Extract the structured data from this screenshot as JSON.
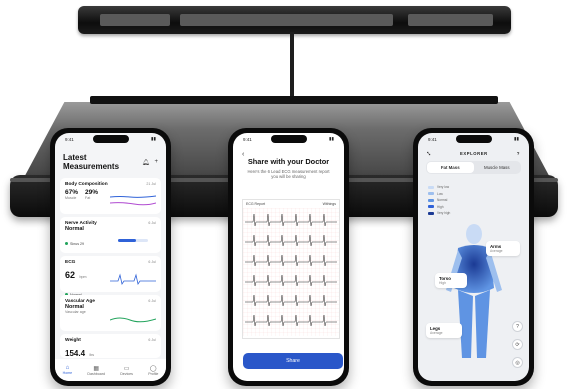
{
  "phone_left": {
    "status_time": "9:41",
    "title": "Latest Measurements",
    "cards": [
      {
        "title": "Body Composition",
        "date": "21 Jul",
        "left_value": "67%",
        "left_label": "Muscle",
        "right_value": "29%",
        "right_label": "Fat"
      },
      {
        "title": "Nerve Activity",
        "date": "6 Jul",
        "value": "Normal",
        "badge": "Sinus 29"
      },
      {
        "title": "ECG",
        "date": "6 Jul",
        "value": "62",
        "unit": "bpm",
        "badge": "Normal"
      },
      {
        "title": "Vascular Age",
        "date": "6 Jul",
        "value": "Normal",
        "note": "Vascular age"
      },
      {
        "title": "Weight",
        "date": "6 Jul",
        "value": "154.4",
        "unit": "lbs"
      }
    ],
    "tabs": [
      "Home",
      "Dashboard",
      "Devices",
      "Profile"
    ],
    "accent": "#2f62d8"
  },
  "phone_center": {
    "status_time": "9:41",
    "title": "Share with your Doctor",
    "subtitle": "Here's the 6 Lead ECG measurement report you will be sharing",
    "sheet_left": "ECG Report",
    "sheet_right": "Withings",
    "share_label": "Share",
    "button_color": "#2a57c9"
  },
  "phone_right": {
    "status_time": "9:41",
    "title": "EXPLORER",
    "segment_fat": "Fat Mass",
    "segment_muscle": "Muscle Mass",
    "legend": [
      "Very low",
      "Low",
      "Normal",
      "High",
      "Very high"
    ],
    "legend_colors": [
      "#c9dbf5",
      "#9dbfee",
      "#5f94e3",
      "#2f62d8",
      "#1b3a94"
    ],
    "callouts": [
      {
        "title": "Arms",
        "sub": "Average"
      },
      {
        "title": "Torso",
        "sub": "High"
      },
      {
        "title": "Legs",
        "sub": "Average"
      }
    ]
  }
}
